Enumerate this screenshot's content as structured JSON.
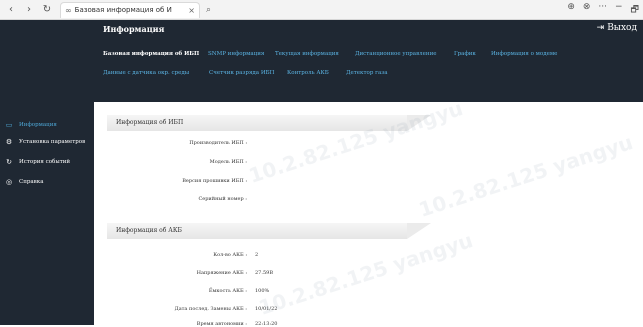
{
  "browser": {
    "back_icon": "‹",
    "forward_icon": "›",
    "refresh_icon": "↻",
    "tab_title": "Базовая информация об И",
    "tab_close": "×",
    "search_icon": "⌕",
    "right_icons": [
      "⊕",
      "⊗",
      "···",
      "−",
      "🗗"
    ]
  },
  "header": {
    "title": "Информация",
    "logout_icon": "⇥",
    "logout_label": "Выход"
  },
  "sidebar": {
    "items": [
      {
        "icon": "▭",
        "label": "Информация",
        "active": true
      },
      {
        "icon": "⚙",
        "label": "Установка параметров",
        "active": false
      },
      {
        "icon": "↻",
        "label": "История событий",
        "active": false
      },
      {
        "icon": "◎",
        "label": "Справка",
        "active": false
      }
    ]
  },
  "subnav": {
    "row1": [
      "Базовая информация об ИБП",
      "SNMP информация",
      "Текущая информация",
      "Дистанционное управление",
      "График",
      "Информация о модеме"
    ],
    "row2": [
      "Данные с датчика окр. среды",
      "Счетчик разряда ИБП",
      "Контроль АКБ",
      "Детектор газа"
    ]
  },
  "ups_section": {
    "title": "Информация об ИБП",
    "fields": [
      {
        "label": "Производитель ИБП :",
        "value": ""
      },
      {
        "label": "Модель ИБП :",
        "value": ""
      },
      {
        "label": "Версия прошивки ИБП :",
        "value": ""
      },
      {
        "label": "Серийный номер :",
        "value": ""
      }
    ]
  },
  "battery_section": {
    "title": "Информация об АКБ",
    "fields": [
      {
        "label": "Кол-во АКБ :",
        "value": "2"
      },
      {
        "label": "Напряжение АКБ :",
        "value": "27.59В"
      },
      {
        "label": "Ёмкость АКБ :",
        "value": "100%"
      },
      {
        "label": "Дата послед. Замены АКБ :",
        "value": "10/01/22"
      },
      {
        "label": "Время автономии :",
        "value": "22:13:20"
      }
    ]
  },
  "watermark_text": "10.2.82.125 yangyu"
}
